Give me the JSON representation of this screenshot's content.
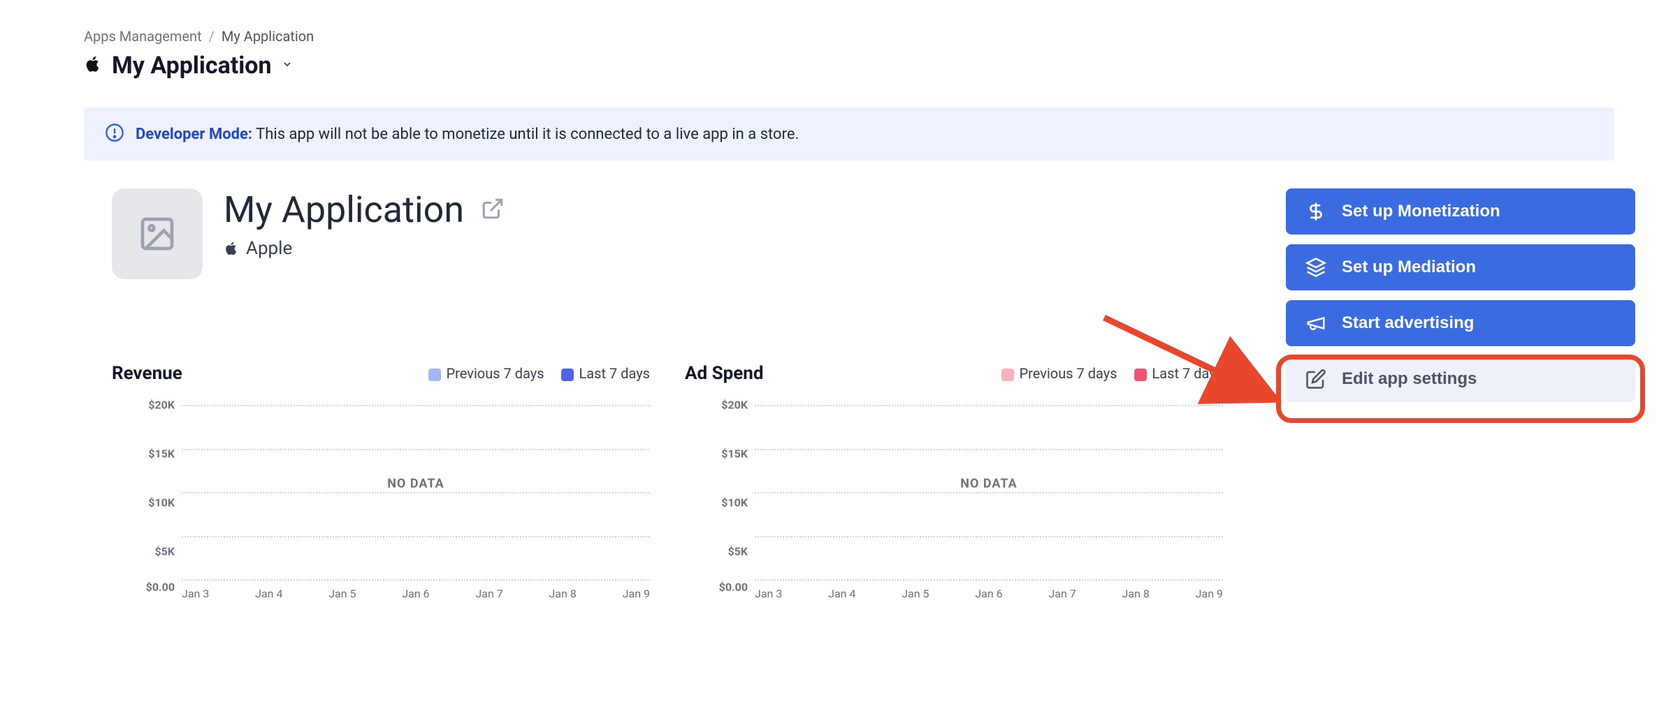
{
  "breadcrumb": {
    "root": "Apps Management",
    "current": "My Application"
  },
  "header": {
    "title": "My Application"
  },
  "banner": {
    "label": "Developer Mode:",
    "text": "This app will not be able to monetize until it is connected to a live app in a store."
  },
  "app": {
    "name": "My Application",
    "platform": "Apple"
  },
  "actions": {
    "monetization": "Set up Monetization",
    "mediation": "Set up Mediation",
    "advertising": "Start advertising",
    "settings": "Edit app settings"
  },
  "legend": {
    "previous": "Previous 7 days",
    "last": "Last 7 days"
  },
  "charts": {
    "revenue": {
      "title": "Revenue",
      "nodata": "NO DATA"
    },
    "adspend": {
      "title": "Ad Spend",
      "nodata": "NO DATA"
    }
  },
  "chart_data": [
    {
      "type": "line",
      "title": "Revenue",
      "categories": [
        "Jan 3",
        "Jan 4",
        "Jan 5",
        "Jan 6",
        "Jan 7",
        "Jan 8",
        "Jan 9"
      ],
      "y_ticks": [
        "$20K",
        "$15K",
        "$10K",
        "$5K",
        "$0.00"
      ],
      "ylim": [
        0,
        20000
      ],
      "series": [
        {
          "name": "Previous 7 days",
          "color": "#a5b4fc",
          "values": [
            null,
            null,
            null,
            null,
            null,
            null,
            null
          ]
        },
        {
          "name": "Last 7 days",
          "color": "#4f63e7",
          "values": [
            null,
            null,
            null,
            null,
            null,
            null,
            null
          ]
        }
      ],
      "annotation": "NO DATA"
    },
    {
      "type": "line",
      "title": "Ad Spend",
      "categories": [
        "Jan 3",
        "Jan 4",
        "Jan 5",
        "Jan 6",
        "Jan 7",
        "Jan 8",
        "Jan 9"
      ],
      "y_ticks": [
        "$20K",
        "$15K",
        "$10K",
        "$5K",
        "$0.00"
      ],
      "ylim": [
        0,
        20000
      ],
      "series": [
        {
          "name": "Previous 7 days",
          "color": "#f7b2bf",
          "values": [
            null,
            null,
            null,
            null,
            null,
            null,
            null
          ]
        },
        {
          "name": "Last 7 days",
          "color": "#ef5472",
          "values": [
            null,
            null,
            null,
            null,
            null,
            null,
            null
          ]
        }
      ],
      "annotation": "NO DATA"
    }
  ]
}
